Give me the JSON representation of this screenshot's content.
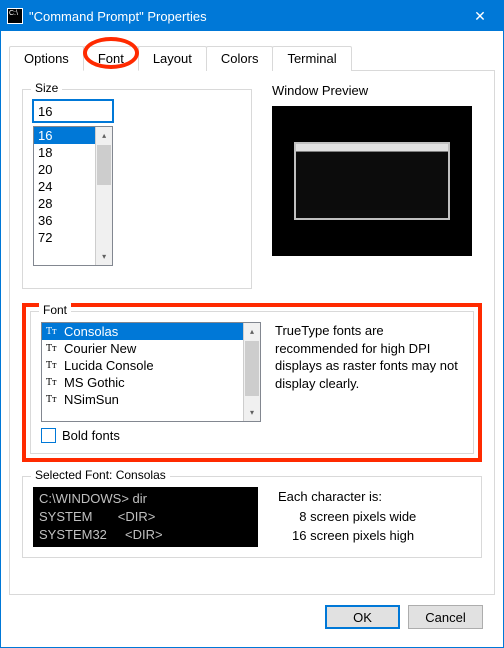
{
  "title": "\"Command Prompt\" Properties",
  "tabs": [
    "Options",
    "Font",
    "Layout",
    "Colors",
    "Terminal"
  ],
  "active_tab": "Font",
  "size": {
    "label": "Size",
    "value": "16",
    "options": [
      "16",
      "18",
      "20",
      "24",
      "28",
      "36",
      "72"
    ],
    "selected": "16"
  },
  "window_preview_label": "Window Preview",
  "font": {
    "label": "Font",
    "options": [
      "Consolas",
      "Courier New",
      "Lucida Console",
      "MS Gothic",
      "NSimSun"
    ],
    "selected": "Consolas",
    "description": "TrueType fonts are recommended for high DPI displays as raster fonts may not display clearly.",
    "bold_label": "Bold fonts",
    "bold_checked": false
  },
  "selected_font": {
    "label": "Selected Font: Consolas",
    "sample_line1": "C:\\WINDOWS> dir",
    "sample_line2": "SYSTEM       <DIR>",
    "sample_line3": "SYSTEM32     <DIR>",
    "each_char_label": "Each character is:",
    "width_text": "8 screen pixels wide",
    "height_text": "16 screen pixels high"
  },
  "buttons": {
    "ok": "OK",
    "cancel": "Cancel"
  }
}
